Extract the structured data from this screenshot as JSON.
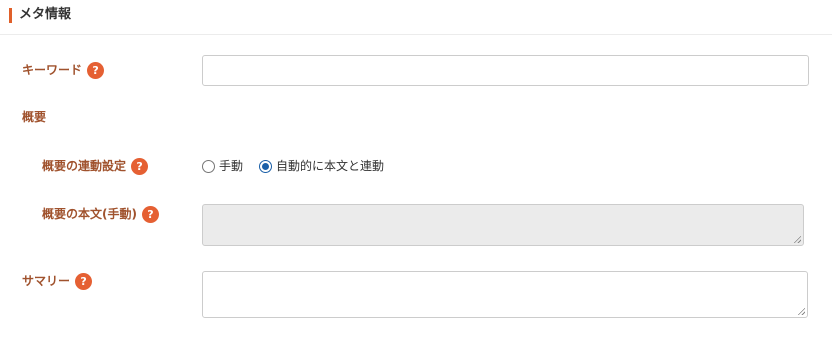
{
  "section": {
    "title": "メタ情報"
  },
  "fields": {
    "keyword": {
      "label": "キーワード",
      "value": "",
      "help": "?"
    },
    "summary_group": {
      "label": "概要"
    },
    "summary_link": {
      "label": "概要の連動設定",
      "help": "?",
      "options": [
        {
          "label": "手動",
          "checked": false
        },
        {
          "label": "自動的に本文と連動",
          "checked": true
        }
      ]
    },
    "summary_body": {
      "label": "概要の本文(手動)",
      "help": "?",
      "value": ""
    },
    "summary_text": {
      "label": "サマリー",
      "help": "?",
      "value": ""
    }
  },
  "colors": {
    "accent": "#e0602a",
    "label": "#a0522d",
    "help_bg": "#e56033",
    "radio": "#1a5fa8"
  }
}
